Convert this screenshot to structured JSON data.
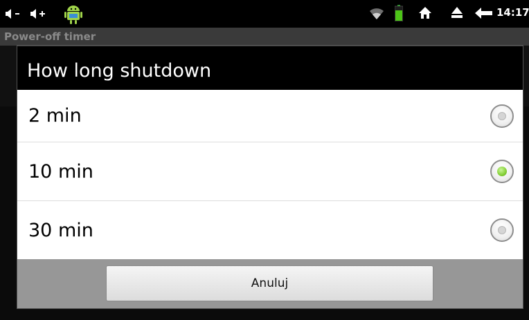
{
  "status_bar": {
    "time": "14:17",
    "icons": [
      "volume-down-icon",
      "volume-up-icon",
      "android-icon",
      "wifi-icon",
      "battery-icon",
      "home-icon",
      "eject-icon",
      "back-icon"
    ]
  },
  "app": {
    "title": "Power-off timer"
  },
  "dialog": {
    "title": "How long shutdown",
    "options": [
      {
        "label": "2 min",
        "selected": false
      },
      {
        "label": "10 min",
        "selected": true
      },
      {
        "label": "30 min",
        "selected": false
      }
    ],
    "cancel_label": "Anuluj"
  },
  "colors": {
    "radio_selected": "#8ad33d",
    "dialog_footer": "#979797",
    "header_bg": "#000000"
  }
}
